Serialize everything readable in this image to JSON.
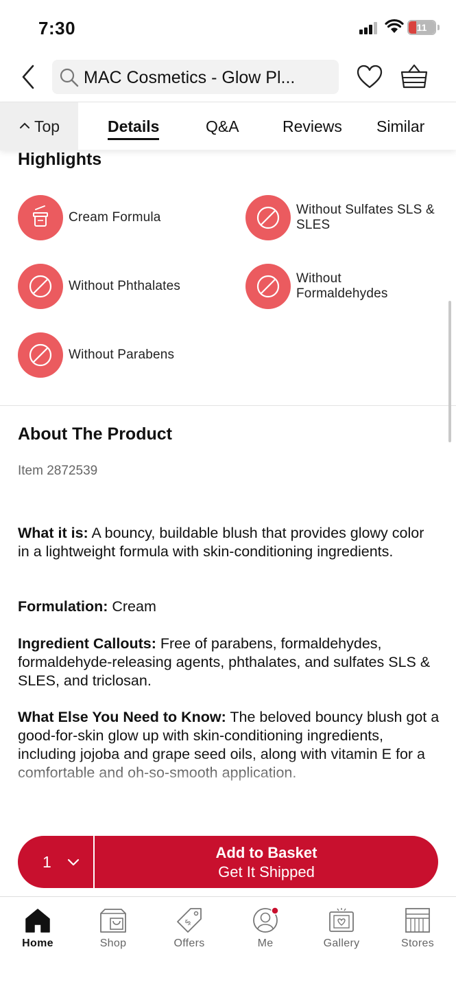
{
  "status_bar": {
    "time": "7:30",
    "battery": "11"
  },
  "header": {
    "search_text": "MAC Cosmetics - Glow Pl..."
  },
  "tabs": {
    "top_label": "Top",
    "items": [
      {
        "label": "Details",
        "active": true
      },
      {
        "label": "Q&A"
      },
      {
        "label": "Reviews"
      },
      {
        "label": "Similar"
      }
    ]
  },
  "highlights": {
    "title": "Highlights",
    "items": [
      {
        "label": "Cream Formula",
        "icon": "cream-jar-icon"
      },
      {
        "label": "Without Sulfates SLS & SLES",
        "icon": "prohibited-icon"
      },
      {
        "label": "Without Phthalates",
        "icon": "prohibited-icon"
      },
      {
        "label": "Without Formaldehydes",
        "icon": "prohibited-icon"
      },
      {
        "label": "Without Parabens",
        "icon": "prohibited-icon"
      }
    ]
  },
  "about": {
    "title": "About The Product",
    "item_number": "Item 2872539",
    "sections": [
      {
        "heading": "What it is:",
        "text": " A bouncy, buildable blush that provides glowy color in a lightweight formula with skin-conditioning ingredients."
      },
      {
        "heading": "Formulation:",
        "text": " Cream"
      },
      {
        "heading": "Ingredient Callouts:",
        "text": " Free of parabens, formaldehydes, formaldehyde-releasing agents, phthalates, and sulfates SLS & SLES, and triclosan."
      },
      {
        "heading": "What Else You Need to Know:",
        "text": " The beloved bouncy blush got a good-for-skin glow up with skin-conditioning ingredients, including jojoba and grape seed oils, along with vitamin E for a comfortable and oh-so-smooth application."
      }
    ]
  },
  "cta": {
    "quantity": "1",
    "primary": "Add to Basket",
    "secondary": "Get It Shipped"
  },
  "bottom_nav": {
    "items": [
      {
        "label": "Home",
        "active": true
      },
      {
        "label": "Shop"
      },
      {
        "label": "Offers"
      },
      {
        "label": "Me"
      },
      {
        "label": "Gallery"
      },
      {
        "label": "Stores"
      }
    ]
  },
  "colors": {
    "accent": "#c8102e",
    "highlight_icon_bg": "#eb5b5f",
    "notification_dot": "#c8102e"
  }
}
